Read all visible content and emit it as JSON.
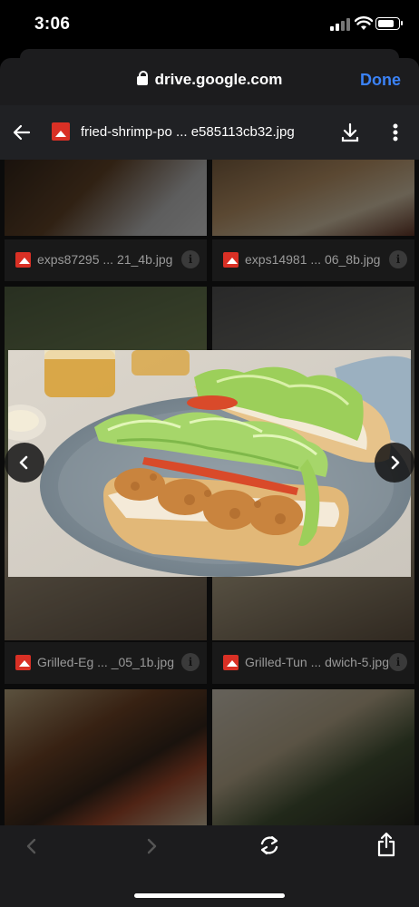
{
  "status_bar": {
    "time": "3:06",
    "battery_level": 0.8
  },
  "browser": {
    "url": "drive.google.com",
    "done_label": "Done"
  },
  "viewer": {
    "file_title": "fried-shrimp-po ... e585113cb32.jpg"
  },
  "grid_files": [
    {
      "name": "exps87295 ... 21_4b.jpg"
    },
    {
      "name": "exps14981 ... 06_8b.jpg"
    },
    {
      "name": "Grilled-Eg ... _05_1b.jpg"
    },
    {
      "name": "Grilled-Tun ... dwich-5.jpg"
    }
  ],
  "icons": {
    "back": "arrow-left-icon",
    "download": "download-icon",
    "more": "more-vert-icon",
    "prev": "chevron-left-icon",
    "next": "chevron-right-icon",
    "reload": "reload-icon",
    "share": "share-icon",
    "info": "info-icon"
  },
  "colors": {
    "accent": "#3b82f6",
    "image_icon": "#d93025"
  }
}
